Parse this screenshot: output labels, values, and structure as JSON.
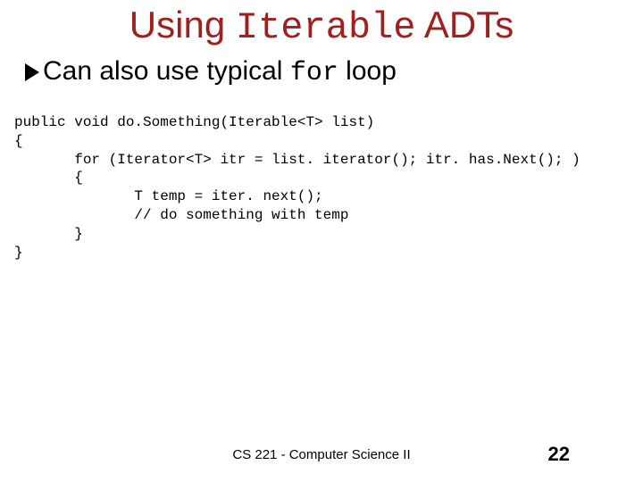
{
  "title": {
    "pre": "Using ",
    "mono": "Iterable",
    "post": " ADTs"
  },
  "bullet": {
    "pre": "Can also use typical ",
    "mono": "for",
    "post": " loop"
  },
  "code": "public void do.Something(Iterable<T> list)\n{\n       for (Iterator<T> itr = list. iterator(); itr. has.Next(); )\n       {\n              T temp = iter. next();\n              // do something with temp\n       }\n}",
  "footer": {
    "course": "CS 221 - Computer Science II",
    "page": "22"
  }
}
